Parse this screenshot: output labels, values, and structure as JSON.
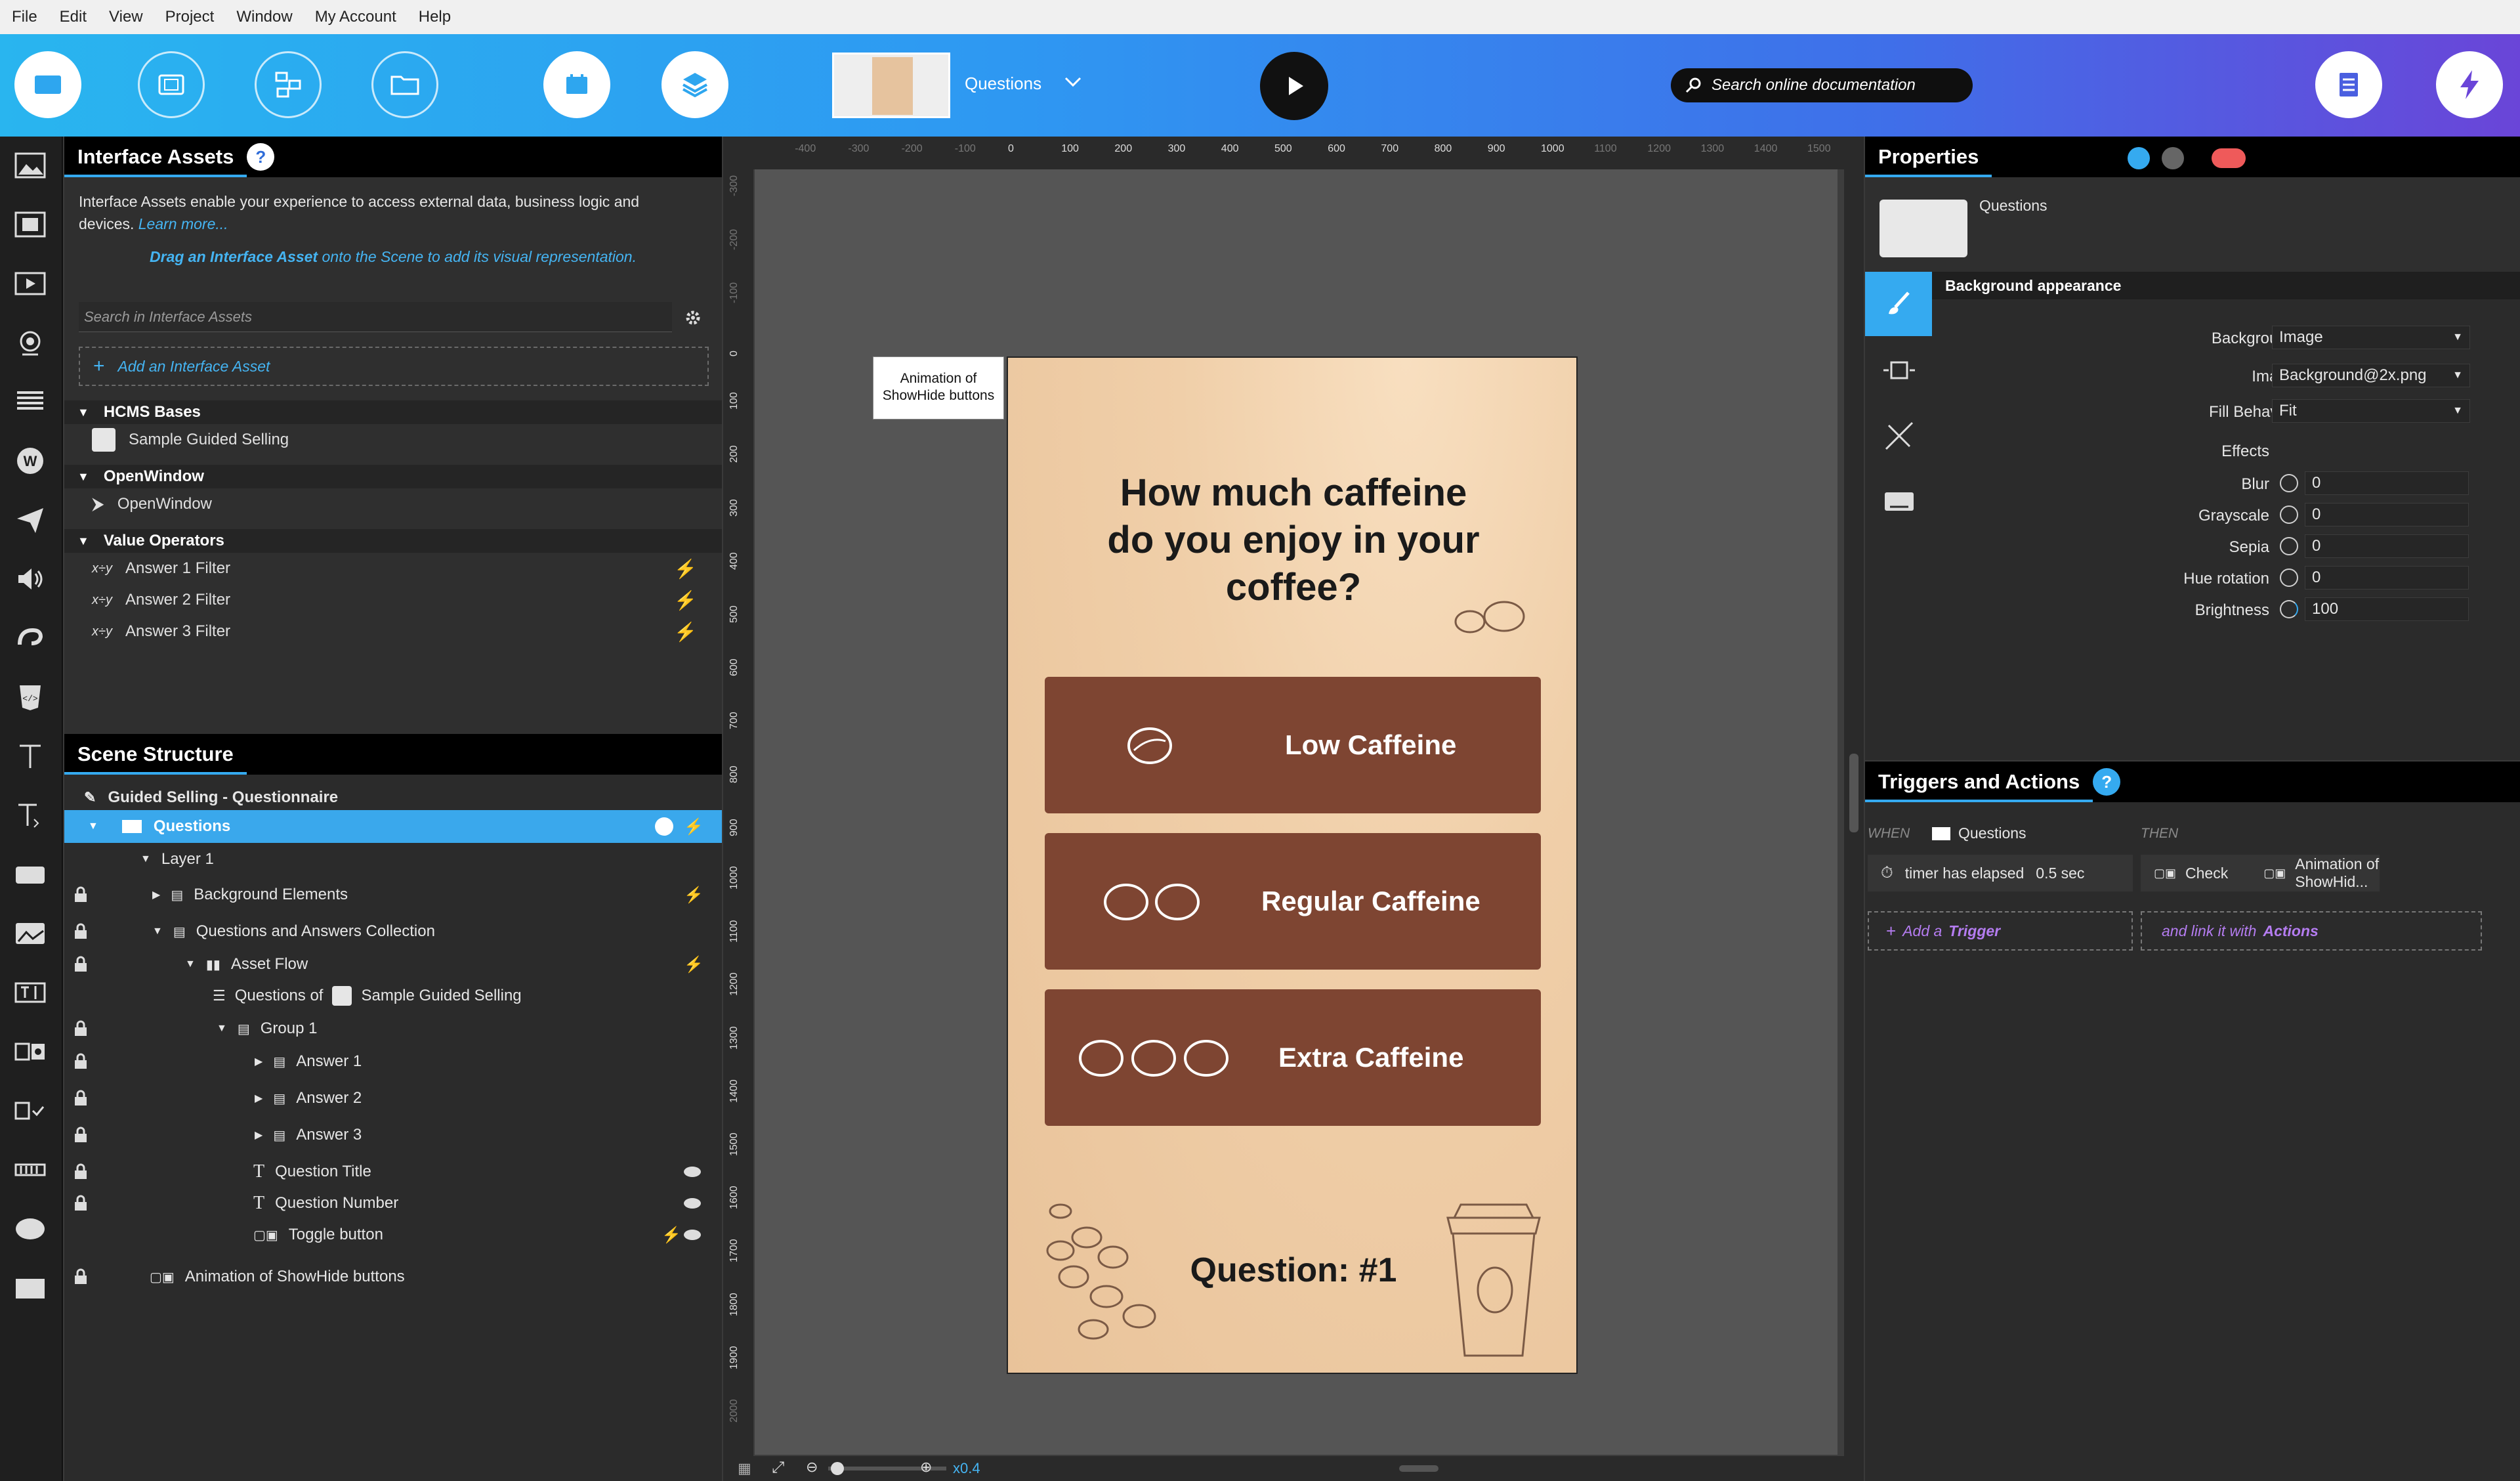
{
  "menu": [
    "File",
    "Edit",
    "View",
    "Project",
    "Window",
    "My Account",
    "Help"
  ],
  "toolbar": {
    "scene_name": "Questions",
    "search_placeholder": "Search online documentation"
  },
  "interface_assets": {
    "title": "Interface Assets",
    "help": "?",
    "desc1": "Interface Assets enable your experience to access external data, business logic and",
    "desc2a": "devices.",
    "desc2b": "Learn more...",
    "drag_a": "Drag an Interface Asset",
    "drag_b": "onto the Scene to add its visual representation.",
    "search_placeholder": "Search in Interface Assets",
    "add": "Add an Interface Asset",
    "hcms_title": "HCMS Bases",
    "hcms_item": "Sample Guided Selling",
    "ow_title": "OpenWindow",
    "ow_item": "OpenWindow",
    "vo_title": "Value Operators",
    "vo_items": [
      "Answer 1 Filter",
      "Answer 2 Filter",
      "Answer 3 Filter"
    ]
  },
  "scene_structure": {
    "title": "Scene Structure",
    "root": "Guided Selling - Questionnaire",
    "items": [
      "Questions",
      "Layer 1",
      "Background Elements",
      "Questions and Answers Collection",
      "Asset Flow",
      "Questions of",
      "Sample Guided Selling",
      "Group 1",
      "Answer 1",
      "Answer 2",
      "Answer 3",
      "Question Title",
      "Question Number",
      "Toggle button",
      "Animation of ShowHide buttons"
    ]
  },
  "canvas": {
    "ruler_top": [
      "-400",
      "-300",
      "-200",
      "-100",
      "0",
      "100",
      "200",
      "300",
      "400",
      "500",
      "600",
      "700",
      "800",
      "900",
      "1000",
      "1100",
      "1200",
      "1300",
      "1400",
      "1500"
    ],
    "ruler_left": [
      "-300",
      "-200",
      "-100",
      "0",
      "100",
      "200",
      "300",
      "400",
      "500",
      "600",
      "700",
      "800",
      "900",
      "1000",
      "1100",
      "1200",
      "1300",
      "1400",
      "1500",
      "1600",
      "1700",
      "1800",
      "1900",
      "2000"
    ],
    "anim_label_1": "Animation of",
    "anim_label_2": "ShowHide buttons",
    "question_line1": "How much caffeine",
    "question_line2": "do you enjoy in your",
    "question_line3": "coffee?",
    "answers": [
      "Low Caffeine",
      "Regular Caffeine",
      "Extra Caffeine"
    ],
    "question_number": "Question: #1",
    "zoom": "x0.4"
  },
  "properties": {
    "title": "Properties",
    "object_name": "Questions",
    "section": "Background appearance",
    "background_label": "Background",
    "background_value": "Image",
    "image_label": "Image",
    "image_value": "Background@2x.png",
    "fill_label": "Fill Behavior",
    "fill_value": "Fit",
    "effects_label": "Effects",
    "blur_label": "Blur",
    "blur_value": "0",
    "grayscale_label": "Grayscale",
    "grayscale_value": "0",
    "sepia_label": "Sepia",
    "sepia_value": "0",
    "hue_label": "Hue rotation",
    "hue_value": "0",
    "brightness_label": "Brightness",
    "brightness_value": "100"
  },
  "triggers": {
    "title": "Triggers and Actions",
    "help": "?",
    "when": "WHEN",
    "then": "THEN",
    "object": "Questions",
    "trigger_text": "timer has elapsed",
    "trigger_value": "0.5 sec",
    "action_verb": "Check",
    "action_target": "Animation of ShowHid...",
    "add_a": "Add a",
    "add_trigger": "Trigger",
    "link_a": "and link it with",
    "link_actions": "Actions"
  },
  "colors": {
    "accent": "#35aaf0",
    "answer_bg": "#7e4532",
    "selected_row": "#3aa8ec"
  }
}
